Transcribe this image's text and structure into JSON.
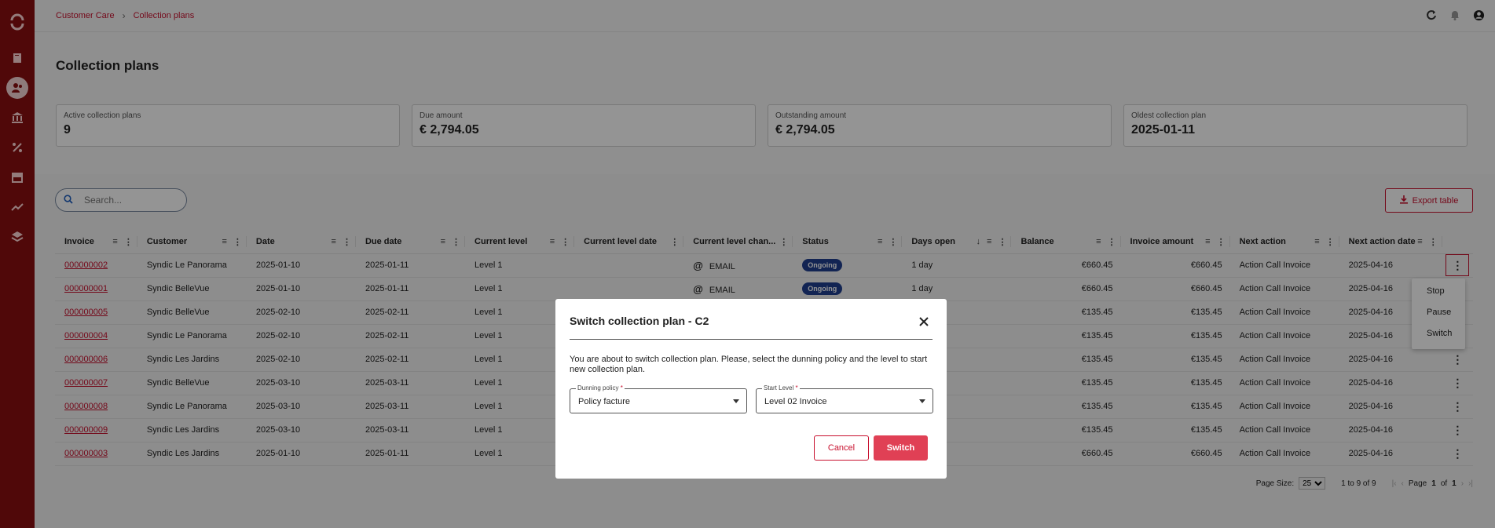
{
  "breadcrumb": {
    "root": "Customer Care",
    "current": "Collection plans"
  },
  "page": {
    "title": "Collection plans"
  },
  "kpis": [
    {
      "label": "Active collection plans",
      "value": "9"
    },
    {
      "label": "Due amount",
      "value": "€ 2,794.05"
    },
    {
      "label": "Outstanding amount",
      "value": "€ 2,794.05"
    },
    {
      "label": "Oldest collection plan",
      "value": "2025-01-11"
    }
  ],
  "search": {
    "placeholder": "Search..."
  },
  "export": {
    "label": "Export table"
  },
  "columns": [
    "Invoice",
    "Customer",
    "Date",
    "Due date",
    "Current level",
    "Current level date",
    "Current level chan...",
    "Status",
    "Days open",
    "Balance",
    "Invoice amount",
    "Next action",
    "Next action date"
  ],
  "rows": [
    {
      "invoice": "000000002",
      "customer": "Syndic Le Panorama",
      "date": "2025-01-10",
      "due": "2025-01-11",
      "level": "Level 1",
      "level_date": "",
      "channel": "EMAIL",
      "status": "Ongoing",
      "days": "1 day",
      "balance": "€660.45",
      "amount": "€660.45",
      "next_action": "Action Call Invoice",
      "next_date": "2025-04-16"
    },
    {
      "invoice": "000000001",
      "customer": "Syndic BelleVue",
      "date": "2025-01-10",
      "due": "2025-01-11",
      "level": "Level 1",
      "level_date": "",
      "channel": "EMAIL",
      "status": "Ongoing",
      "days": "1 day",
      "balance": "€660.45",
      "amount": "€660.45",
      "next_action": "Action Call Invoice",
      "next_date": "2025-04-16"
    },
    {
      "invoice": "000000005",
      "customer": "Syndic BelleVue",
      "date": "2025-02-10",
      "due": "2025-02-11",
      "level": "Level 1",
      "level_date": "",
      "channel": "",
      "status": "",
      "days": "",
      "balance": "€135.45",
      "amount": "€135.45",
      "next_action": "Action Call Invoice",
      "next_date": "2025-04-16"
    },
    {
      "invoice": "000000004",
      "customer": "Syndic Le Panorama",
      "date": "2025-02-10",
      "due": "2025-02-11",
      "level": "Level 1",
      "level_date": "",
      "channel": "",
      "status": "",
      "days": "",
      "balance": "€135.45",
      "amount": "€135.45",
      "next_action": "Action Call Invoice",
      "next_date": "2025-04-16"
    },
    {
      "invoice": "000000006",
      "customer": "Syndic Les Jardins",
      "date": "2025-02-10",
      "due": "2025-02-11",
      "level": "Level 1",
      "level_date": "",
      "channel": "",
      "status": "",
      "days": "",
      "balance": "€135.45",
      "amount": "€135.45",
      "next_action": "Action Call Invoice",
      "next_date": "2025-04-16"
    },
    {
      "invoice": "000000007",
      "customer": "Syndic BelleVue",
      "date": "2025-03-10",
      "due": "2025-03-11",
      "level": "Level 1",
      "level_date": "",
      "channel": "",
      "status": "",
      "days": "",
      "balance": "€135.45",
      "amount": "€135.45",
      "next_action": "Action Call Invoice",
      "next_date": "2025-04-16"
    },
    {
      "invoice": "000000008",
      "customer": "Syndic Le Panorama",
      "date": "2025-03-10",
      "due": "2025-03-11",
      "level": "Level 1",
      "level_date": "",
      "channel": "",
      "status": "",
      "days": "",
      "balance": "€135.45",
      "amount": "€135.45",
      "next_action": "Action Call Invoice",
      "next_date": "2025-04-16"
    },
    {
      "invoice": "000000009",
      "customer": "Syndic Les Jardins",
      "date": "2025-03-10",
      "due": "2025-03-11",
      "level": "Level 1",
      "level_date": "",
      "channel": "",
      "status": "",
      "days": "",
      "balance": "€135.45",
      "amount": "€135.45",
      "next_action": "Action Call Invoice",
      "next_date": "2025-04-16"
    },
    {
      "invoice": "000000003",
      "customer": "Syndic Les Jardins",
      "date": "2025-01-10",
      "due": "2025-01-11",
      "level": "Level 1",
      "level_date": "",
      "channel": "",
      "status": "",
      "days": "",
      "balance": "€660.45",
      "amount": "€660.45",
      "next_action": "Action Call Invoice",
      "next_date": "2025-04-16"
    }
  ],
  "row_menu": {
    "items": [
      "Stop",
      "Pause",
      "Switch"
    ]
  },
  "paging": {
    "size_label": "Page Size:",
    "size_value": "25",
    "range": "1 to 9 of 9",
    "page_prefix": "Page",
    "page": "1",
    "of": "of",
    "total": "1"
  },
  "modal": {
    "title": "Switch collection plan - C2",
    "text": "You are about to switch collection plan. Please, select the dunning policy and the level to start new collection plan.",
    "policy_label": "Dunning policy",
    "policy_value": "Policy facture",
    "level_label": "Start Level",
    "level_value": "Level 02 Invoice",
    "required_mark": "*",
    "cancel": "Cancel",
    "submit": "Switch"
  },
  "colors": {
    "brand": "#8b0f10",
    "accent": "#c8102e",
    "badge": "#1f3f8f",
    "switch": "#e04055"
  }
}
